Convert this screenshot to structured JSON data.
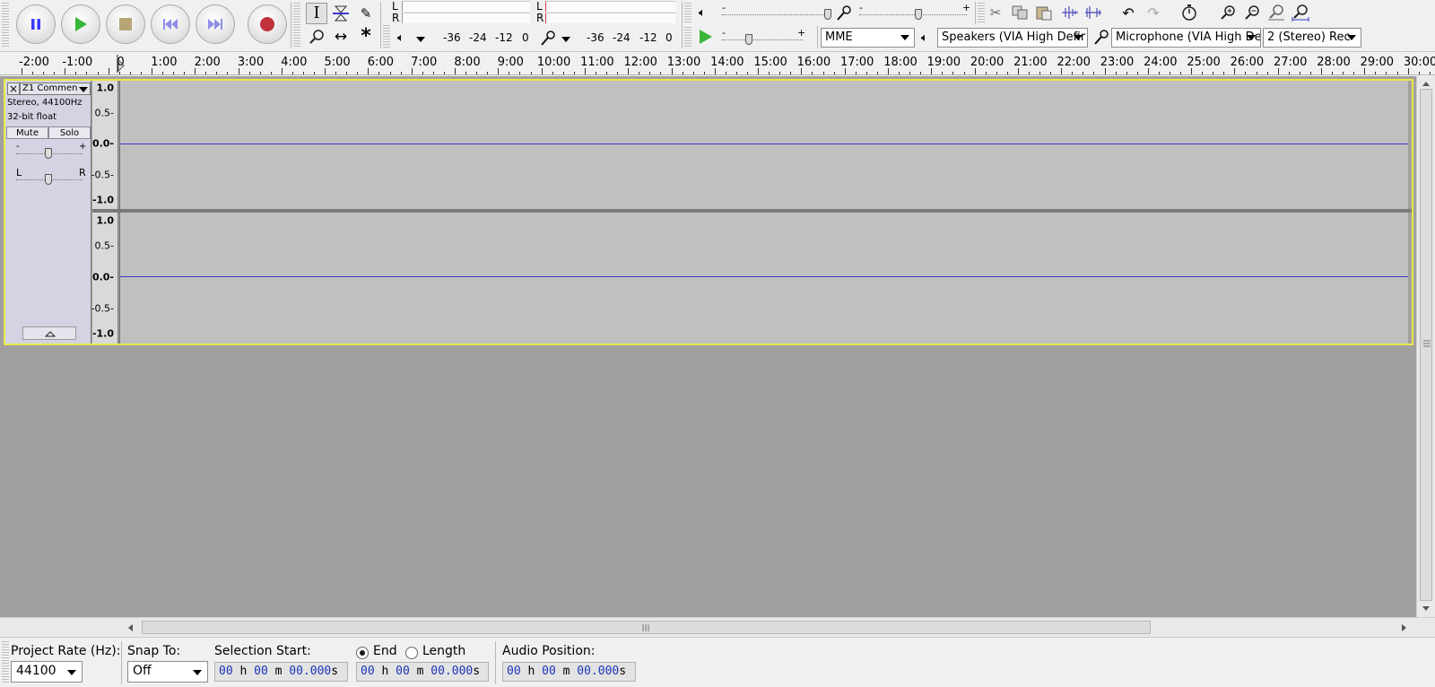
{
  "toolbar": {
    "transport": [
      "pause",
      "play",
      "stop",
      "skip-to-start",
      "skip-to-end",
      "record"
    ],
    "meters": {
      "play_lr_top": "L",
      "play_lr_bottom": "R",
      "rec_lr_top": "L",
      "rec_lr_bottom": "R",
      "play_scale": [
        "-36",
        "-24",
        "-12",
        "0"
      ],
      "rec_scale": [
        "-36",
        "-24",
        "-12",
        "0"
      ]
    },
    "mixer": {
      "minus": "-",
      "plus": "+"
    },
    "device": {
      "host": "MME",
      "output": "Speakers (VIA High Defir",
      "input": "Microphone (VIA High De",
      "channels": "2 (Stereo) Rec"
    }
  },
  "ruler": {
    "labels": [
      "-2:00",
      "-1:00",
      "0",
      "1:00",
      "2:00",
      "3:00",
      "4:00",
      "5:00",
      "6:00",
      "7:00",
      "8:00",
      "9:00",
      "10:00",
      "11:00",
      "12:00",
      "13:00",
      "14:00",
      "15:00",
      "16:00",
      "17:00",
      "18:00",
      "19:00",
      "20:00",
      "21:00",
      "22:00",
      "23:00",
      "24:00",
      "25:00",
      "26:00",
      "27:00",
      "28:00",
      "29:00",
      "30:00"
    ]
  },
  "track": {
    "name": "Z1 Commen",
    "info_line1": "Stereo, 44100Hz",
    "info_line2": "32-bit float",
    "mute_label": "Mute",
    "solo_label": "Solo",
    "gain_minus": "-",
    "gain_plus": "+",
    "pan_left": "L",
    "pan_right": "R",
    "vruler_labels": [
      "1.0",
      "0.5-",
      "0.0-",
      "-0.5-",
      "-1.0"
    ]
  },
  "selection_bar": {
    "project_rate_label": "Project Rate (Hz):",
    "project_rate_value": "44100",
    "snap_label": "Snap To:",
    "snap_value": "Off",
    "selection_start_label": "Selection Start:",
    "end_label": "End",
    "length_label": "Length",
    "end_selected": true,
    "audio_position_label": "Audio Position:",
    "time_digits": [
      "00",
      "h",
      "00",
      "m",
      "00.000",
      "s"
    ]
  }
}
